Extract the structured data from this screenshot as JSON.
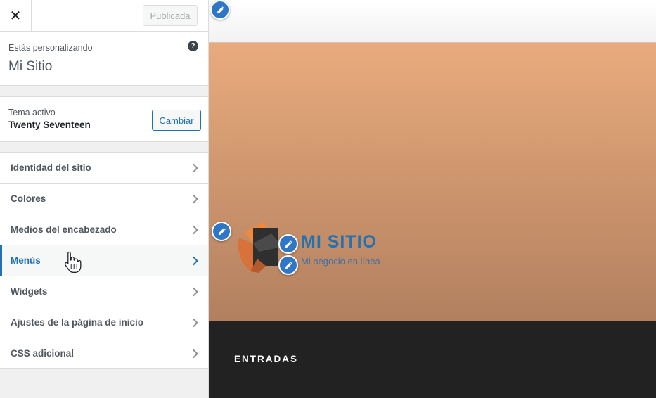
{
  "sidebar": {
    "close_label": "✕",
    "publish_label": "Publicada",
    "customizing_label": "Estás personalizando",
    "site_name": "Mi Sitio",
    "help_label": "?",
    "theme": {
      "label": "Tema activo",
      "name": "Twenty Seventeen",
      "change_label": "Cambiar"
    },
    "menu": [
      {
        "label": "Identidad del sitio"
      },
      {
        "label": "Colores"
      },
      {
        "label": "Medios del encabezado"
      },
      {
        "label": "Menús"
      },
      {
        "label": "Widgets"
      },
      {
        "label": "Ajustes de la página de inicio"
      },
      {
        "label": "CSS adicional"
      }
    ],
    "active_item": "Menús"
  },
  "preview": {
    "site_title": "MI SITIO",
    "tagline": "Mi negocio en línea",
    "section_heading": "ENTRADAS"
  },
  "colors": {
    "accent": "#2271b1",
    "header_gradient_top": "#e9ab7d",
    "header_gradient_bottom": "#b2805f",
    "footer": "#222222",
    "edit_pin": "#2f77c6"
  },
  "icons": {
    "close": "close-icon",
    "help": "help-icon",
    "chevron": "chevron-right-icon",
    "edit": "pencil-icon",
    "cursor": "hand-pointer-icon"
  }
}
